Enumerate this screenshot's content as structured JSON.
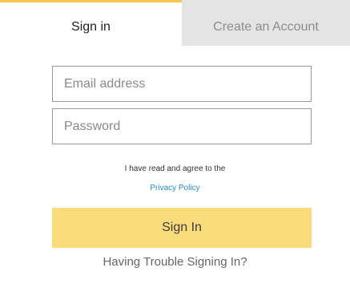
{
  "tabs": {
    "signin_label": "Sign in",
    "create_label": "Create an Account"
  },
  "form": {
    "email_placeholder": "Email address",
    "password_placeholder": "Password",
    "agree_text": "I have read and agree to the",
    "privacy_label": "Privacy Policy",
    "signin_button_label": "Sign In",
    "trouble_label": "Having Trouble Signing In?"
  },
  "colors": {
    "accent": "#f6c84c",
    "button_bg": "#fbdc7c",
    "inactive_tab_bg": "#e4e4e4",
    "link": "#2a8bc9"
  }
}
